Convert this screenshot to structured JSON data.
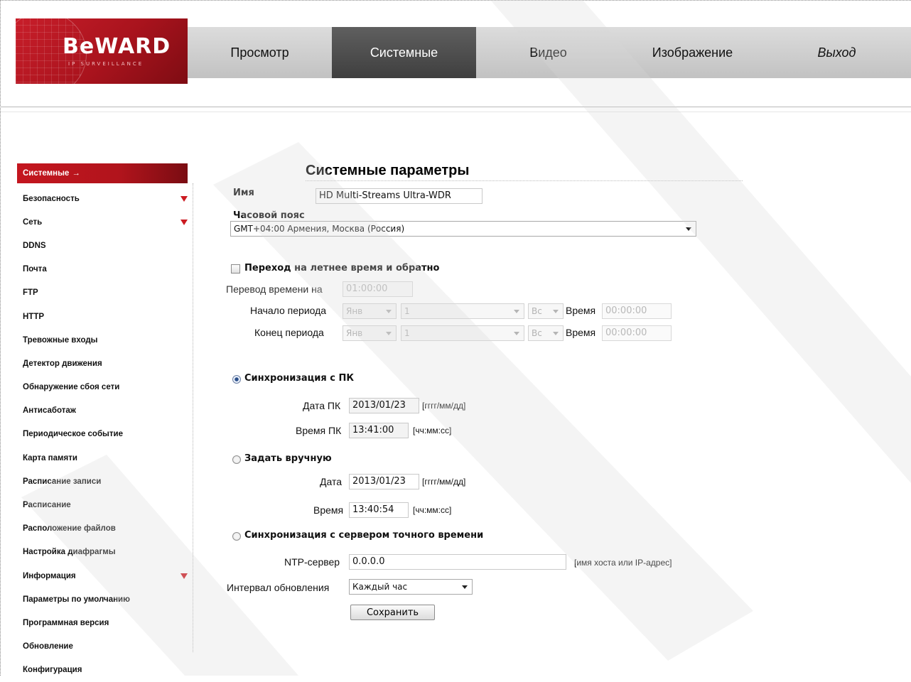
{
  "logo": {
    "text": "BeWARD",
    "sub": "IP SURVEILLANCE"
  },
  "nav": [
    "Просмотр",
    "Системные",
    "Видео",
    "Изображение",
    "Выход"
  ],
  "sidebar": {
    "items": [
      {
        "label": "Системные",
        "active": true,
        "suffix": "→"
      },
      {
        "label": "Безопасность",
        "dropdown": true
      },
      {
        "label": "Сеть",
        "dropdown": true
      },
      {
        "label": "DDNS"
      },
      {
        "label": "Почта"
      },
      {
        "label": "FTP"
      },
      {
        "label": "HTTP"
      },
      {
        "label": "Тревожные входы"
      },
      {
        "label": "Детектор движения"
      },
      {
        "label": "Обнаружение сбоя сети"
      },
      {
        "label": "Антисаботаж"
      },
      {
        "label": "Периодическое событие"
      },
      {
        "label": "Карта памяти"
      },
      {
        "label": "Расписание записи"
      },
      {
        "label": "Расписание"
      },
      {
        "label": "Расположение файлов"
      },
      {
        "label": "Настройка диафрагмы"
      },
      {
        "label": "Информация",
        "dropdown": true
      },
      {
        "label": "Параметры по умолчанию"
      },
      {
        "label": "Программная версия"
      },
      {
        "label": "Обновление"
      },
      {
        "label": "Конфигурация"
      }
    ]
  },
  "main": {
    "title": "Системные параметры",
    "name_label": "Имя",
    "name_value": "HD Multi-Streams Ultra-WDR",
    "timezone_label": "Часовой пояс",
    "timezone_value": "GMT+04:00 Армения, Москва (Россия)",
    "dst": {
      "label": "Переход на летнее время и обратно",
      "shift_label": "Перевод времени на",
      "shift_value": "01:00:00",
      "start_label": "Начало периода",
      "end_label": "Конец периода",
      "month": "Янв",
      "week": "1",
      "day": "Вс",
      "time_label": "Время",
      "time_value": "00:00:00"
    },
    "sync_pc": {
      "label": "Синхронизация с ПК",
      "date_label": "Дата ПК",
      "date_value": "2013/01/23",
      "date_hint": "[гггг/мм/дд]",
      "time_label": "Время ПК",
      "time_value": "13:41:00",
      "time_hint": "[чч:мм:сс]"
    },
    "manual": {
      "label": "Задать вручную",
      "date_label": "Дата",
      "date_value": "2013/01/23",
      "date_hint": "[гггг/мм/дд]",
      "time_label": "Время",
      "time_value": "13:40:54",
      "time_hint": "[чч:мм:сс]"
    },
    "ntp": {
      "label": "Синхронизация с сервером точного времени",
      "server_label": "NTP-сервер",
      "server_value": "0.0.0.0",
      "server_hint": "[имя хоста или IP-адрес]",
      "interval_label": "Интервал обновления",
      "interval_value": "Каждый час"
    },
    "save_label": "Сохранить"
  },
  "colors": {
    "accent": "#c4161f",
    "nav_active": "#4a4a4a"
  }
}
